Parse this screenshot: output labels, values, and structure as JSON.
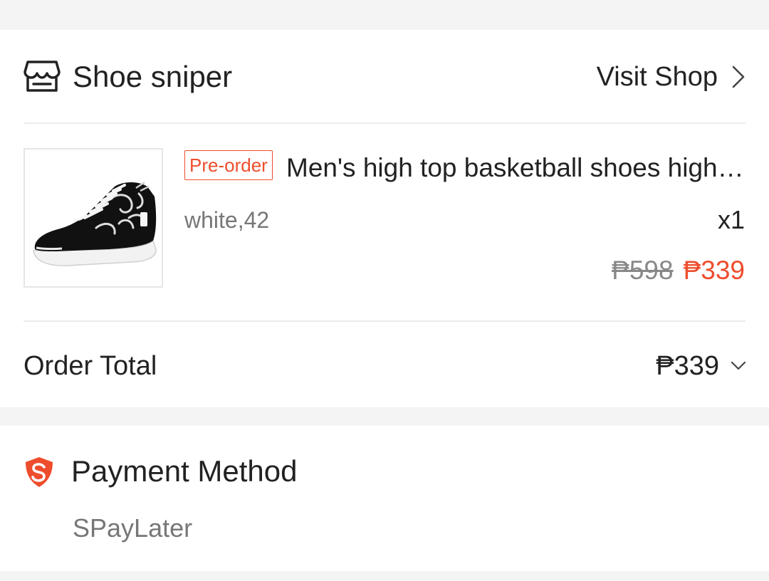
{
  "shop": {
    "name": "Shoe sniper",
    "visit_label": "Visit Shop"
  },
  "product": {
    "badge": "Pre-order",
    "title": "Men's high top basketball shoes high top sneakers",
    "variation": "white,42",
    "quantity": "x1",
    "original_price": "₱598",
    "current_price": "₱339"
  },
  "order_total": {
    "label": "Order Total",
    "value": "₱339"
  },
  "payment": {
    "title": "Payment Method",
    "method": "SPayLater"
  },
  "colors": {
    "accent": "#ee4d2d",
    "muted_text": "#777777",
    "background": "#f4f4f4"
  },
  "icons": {
    "shop": "shop-icon",
    "visit_shop": "chevron-right-icon",
    "order_total": "chevron-down-icon",
    "payment": "shopee-shield-icon",
    "product": "sneaker-image"
  }
}
